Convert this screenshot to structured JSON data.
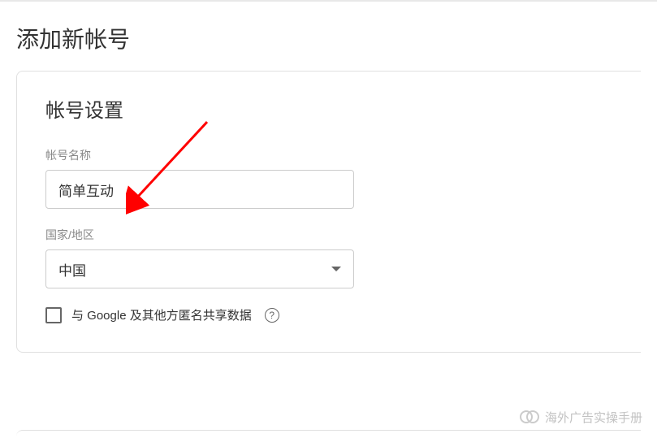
{
  "page_title": "添加新帐号",
  "card": {
    "title": "帐号设置",
    "fields": {
      "account_name": {
        "label": "帐号名称",
        "value": "简单互动"
      },
      "country": {
        "label": "国家/地区",
        "value": "中国"
      },
      "anon_share": {
        "label": "与 Google 及其他方匿名共享数据"
      }
    }
  },
  "watermark": "海外广告实操手册"
}
